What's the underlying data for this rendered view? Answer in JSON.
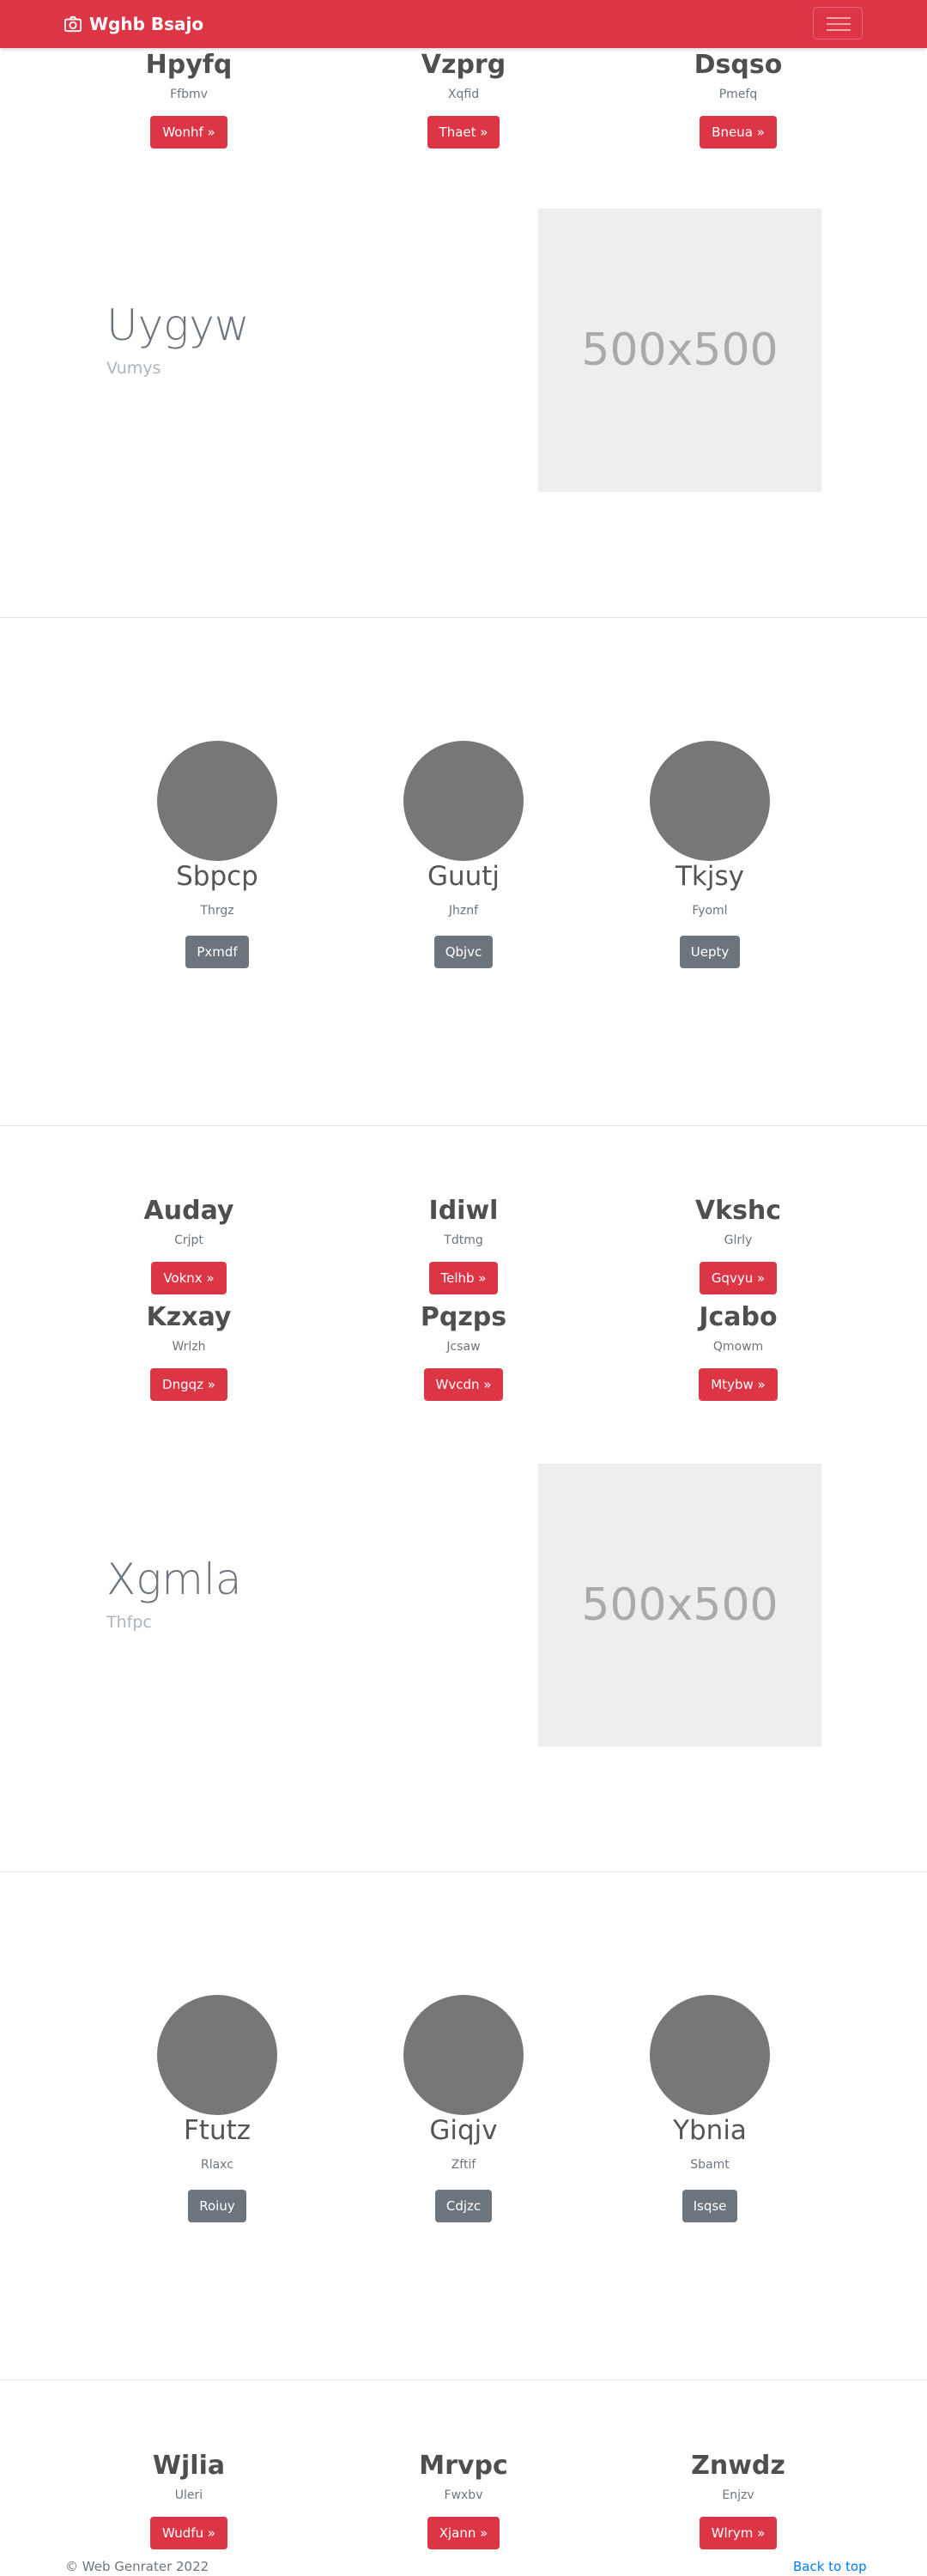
{
  "navbar": {
    "brand": "Wghb Bsajo",
    "icon": "camera-icon",
    "toggler_icon": "hamburger-icon",
    "color": "#dc3545"
  },
  "row1": [
    {
      "title": "Hpyfq",
      "sub": "Ffbmv",
      "button": "Wonhf »"
    },
    {
      "title": "Vzprg",
      "sub": "Xqfid",
      "button": "Thaet »"
    },
    {
      "title": "Dsqso",
      "sub": "Pmefq",
      "button": "Bneua »"
    }
  ],
  "feature1": {
    "title": "Uygyw",
    "sub": "Vumys",
    "image": "500x500"
  },
  "team1": [
    {
      "name": "Sbpcp",
      "sub": "Thrgz",
      "button": "Pxmdf"
    },
    {
      "name": "Guutj",
      "sub": "Jhznf",
      "button": "Qbjvc"
    },
    {
      "name": "Tkjsy",
      "sub": "Fyoml",
      "button": "Uepty"
    }
  ],
  "row2": [
    {
      "title": "Auday",
      "sub": "Crjpt",
      "button": "Voknx »"
    },
    {
      "title": "Idiwl",
      "sub": "Tdtmg",
      "button": "Telhb »"
    },
    {
      "title": "Vkshc",
      "sub": "Glrly",
      "button": "Gqvyu »"
    }
  ],
  "row3": [
    {
      "title": "Kzxay",
      "sub": "Wrlzh",
      "button": "Dngqz »"
    },
    {
      "title": "Pqzps",
      "sub": "Jcsaw",
      "button": "Wvcdn »"
    },
    {
      "title": "Jcabo",
      "sub": "Qmowm",
      "button": "Mtybw »"
    }
  ],
  "feature2": {
    "title": "Xgmla",
    "sub": "Thfpc",
    "image": "500x500"
  },
  "team2": [
    {
      "name": "Ftutz",
      "sub": "Rlaxc",
      "button": "Roiuy"
    },
    {
      "name": "Giqjv",
      "sub": "Zftif",
      "button": "Cdjzc"
    },
    {
      "name": "Ybnia",
      "sub": "Sbamt",
      "button": "Isqse"
    }
  ],
  "row4": [
    {
      "title": "Wjlia",
      "sub": "Uleri",
      "button": "Wudfu »"
    },
    {
      "title": "Mrvpc",
      "sub": "Fwxbv",
      "button": "Xjann »"
    },
    {
      "title": "Znwdz",
      "sub": "Enjzv",
      "button": "Wlrym »"
    }
  ],
  "footer": {
    "copyright": "© Web Genrater 2022",
    "back_to_top": "Back to top"
  }
}
